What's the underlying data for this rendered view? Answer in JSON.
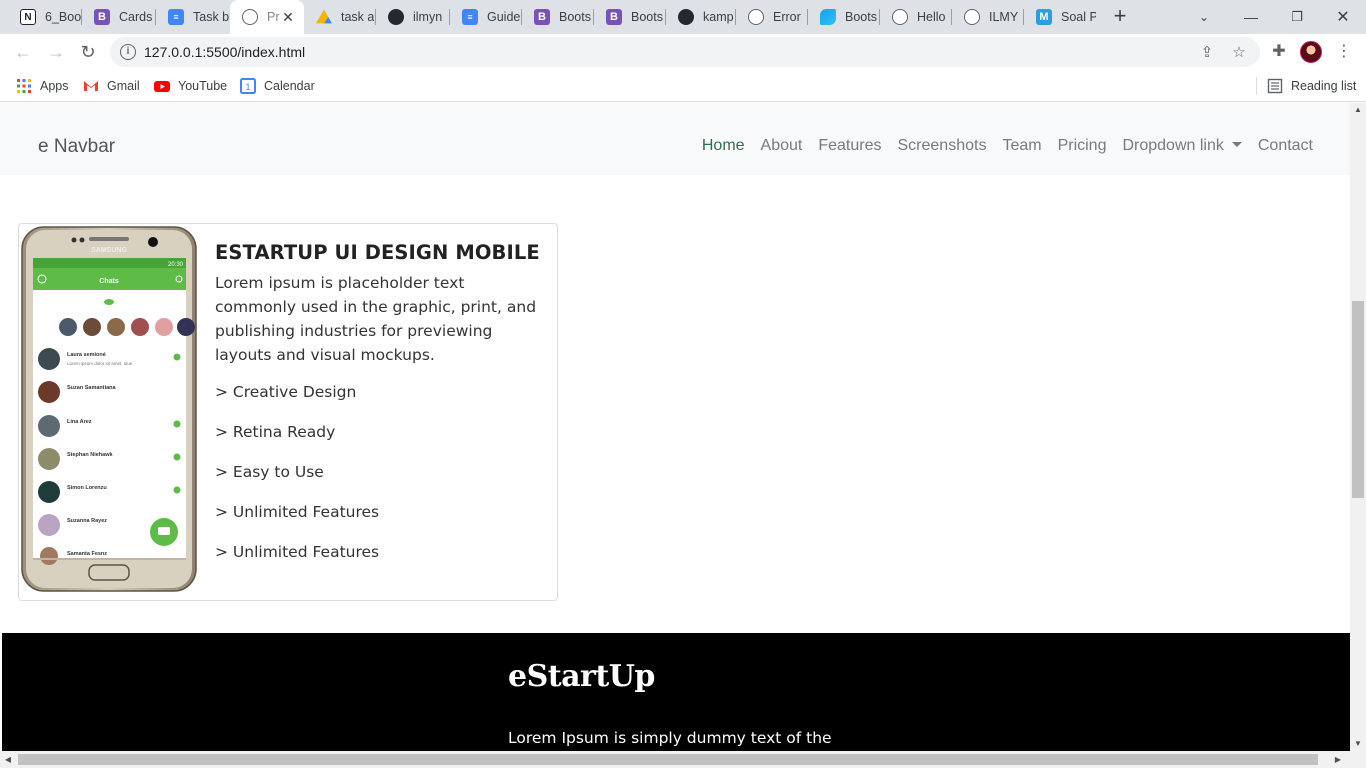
{
  "browser": {
    "tabs": [
      {
        "title": "6_Boo",
        "icon": "notion-icon"
      },
      {
        "title": "Cards",
        "icon": "bootstrap-icon"
      },
      {
        "title": "Task b",
        "icon": "docs-icon"
      },
      {
        "title": "Pr",
        "icon": "globe-icon",
        "active": true
      },
      {
        "title": "task a",
        "icon": "drive-icon"
      },
      {
        "title": "ilmyn",
        "icon": "github-icon"
      },
      {
        "title": "Guide",
        "icon": "docs-icon"
      },
      {
        "title": "Boots",
        "icon": "bootstrap-icon"
      },
      {
        "title": "Boots",
        "icon": "bootstrap-icon"
      },
      {
        "title": "kamp",
        "icon": "github-icon"
      },
      {
        "title": "Error",
        "icon": "globe-icon"
      },
      {
        "title": "Boots",
        "icon": "tailwind-icon"
      },
      {
        "title": "Hello",
        "icon": "globe-icon"
      },
      {
        "title": "ILMY",
        "icon": "globe-icon"
      },
      {
        "title": "Soal P",
        "icon": "moodle-icon"
      }
    ],
    "url": "127.0.0.1:5500/index.html",
    "bookmarks": [
      {
        "label": "Apps",
        "icon": "apps-grid-icon"
      },
      {
        "label": "Gmail",
        "icon": "gmail-icon"
      },
      {
        "label": "YouTube",
        "icon": "youtube-icon"
      },
      {
        "label": "Calendar",
        "icon": "calendar-icon"
      }
    ],
    "reading_list": "Reading list",
    "colors": {
      "tab_strip": "#dee1e6",
      "active_tab": "#ffffff",
      "bootstrap_purple": "#7952b3",
      "docs_blue": "#4285f4"
    }
  },
  "page": {
    "navbar": {
      "brand": "e Navbar",
      "links": [
        "Home",
        "About",
        "Features",
        "Screenshots",
        "Team",
        "Pricing",
        "Dropdown link",
        "Contact"
      ],
      "active": "Home"
    },
    "card": {
      "title_bold": "ESTARTUP",
      "title_rest": " UI DESIGN MOBILE",
      "text": "Lorem ipsum is placeholder text commonly used in the graphic, print, and publishing industries for previewing layouts and visual mockups.",
      "features": [
        "> Creative Design",
        "> Retina Ready",
        "> Easy to Use",
        "> Unlimited Features",
        "> Unlimited Features"
      ],
      "phone": {
        "brand": "SAMSUNG",
        "time": "20:30",
        "app_title": "Chats",
        "contacts": [
          "Laura semioné",
          "Suzan Samantiana",
          "Lina Arez",
          "Stephan Niehawk",
          "Simon Lorenzu",
          "Suzanna Rayez",
          "Samanta Fesnz"
        ],
        "preview": "Lorem ipsum dolor sit amet, alue",
        "accent": "#5dbb46"
      }
    },
    "footer": {
      "title": "eStartUp",
      "text": "Lorem Ipsum is simply dummy text of the"
    }
  }
}
